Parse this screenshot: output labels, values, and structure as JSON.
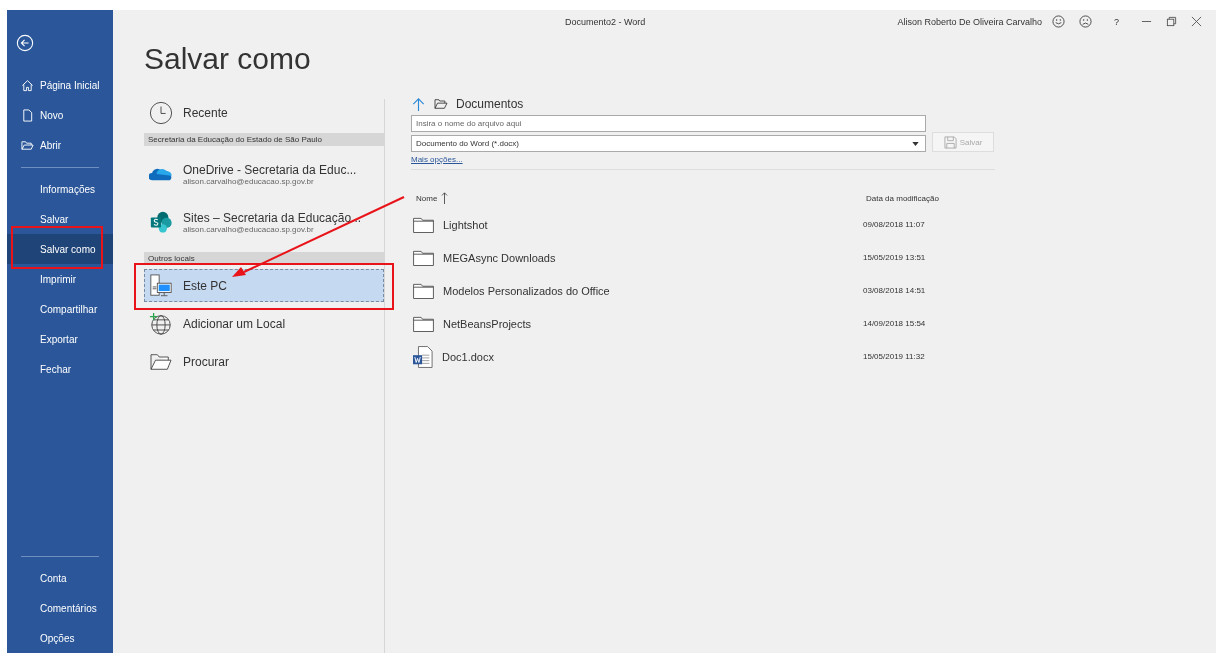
{
  "window": {
    "title": "Documento2  -  Word",
    "user": "Alison Roberto De Oliveira Carvalho",
    "help": "?"
  },
  "sidebar": {
    "items": [
      {
        "label": "Página Inicial",
        "selected": false
      },
      {
        "label": "Novo",
        "selected": false
      },
      {
        "label": "Abrir",
        "selected": false
      },
      {
        "label": "Informações",
        "selected": false
      },
      {
        "label": "Salvar",
        "selected": false
      },
      {
        "label": "Salvar como",
        "selected": true
      },
      {
        "label": "Imprimir",
        "selected": false
      },
      {
        "label": "Compartilhar",
        "selected": false
      },
      {
        "label": "Exportar",
        "selected": false
      },
      {
        "label": "Fechar",
        "selected": false
      },
      {
        "label": "Conta",
        "selected": false
      },
      {
        "label": "Comentários",
        "selected": false
      },
      {
        "label": "Opções",
        "selected": false
      }
    ]
  },
  "page_title": "Salvar como",
  "places": [
    {
      "kind": "recent",
      "label": "Recente"
    },
    {
      "kind": "header",
      "label": "Secretaria da Educação do Estado de São Paulo"
    },
    {
      "kind": "onedrive",
      "label": "OneDrive - Secretaria da Educ...",
      "sub": "alison.carvalho@educacao.sp.gov.br",
      "selected": false
    },
    {
      "kind": "sites",
      "label": "Sites – Secretaria da Educação...",
      "sub": "alison.carvalho@educacao.sp.gov.br",
      "selected": false
    },
    {
      "kind": "header",
      "label": "Outros locais"
    },
    {
      "kind": "pc",
      "label": "Este PC",
      "selected": true
    },
    {
      "kind": "add",
      "label": "Adicionar um Local",
      "selected": false
    },
    {
      "kind": "browse",
      "label": "Procurar",
      "selected": false
    }
  ],
  "save": {
    "folder": "Documentos",
    "filename": {
      "placeholder": "Insira o nome do arquivo aqui"
    },
    "filetype": "Documento do Word (*.docx)",
    "save_button": "Salvar",
    "more_options": "Mais opções..."
  },
  "files": {
    "columns": [
      "Nome",
      "Data da modificação"
    ],
    "rows": [
      {
        "kind": "folder",
        "name": "Lightshot",
        "date": "09/08/2018 11:07"
      },
      {
        "kind": "folder",
        "name": "MEGAsync Downloads",
        "date": "15/05/2019 13:51"
      },
      {
        "kind": "folder",
        "name": "Modelos Personalizados do Office",
        "date": "03/08/2018 14:51"
      },
      {
        "kind": "folder",
        "name": "NetBeansProjects",
        "date": "14/09/2018 15:54"
      },
      {
        "kind": "word",
        "name": "Doc1.docx",
        "date": "15/05/2019 11:32"
      }
    ]
  }
}
